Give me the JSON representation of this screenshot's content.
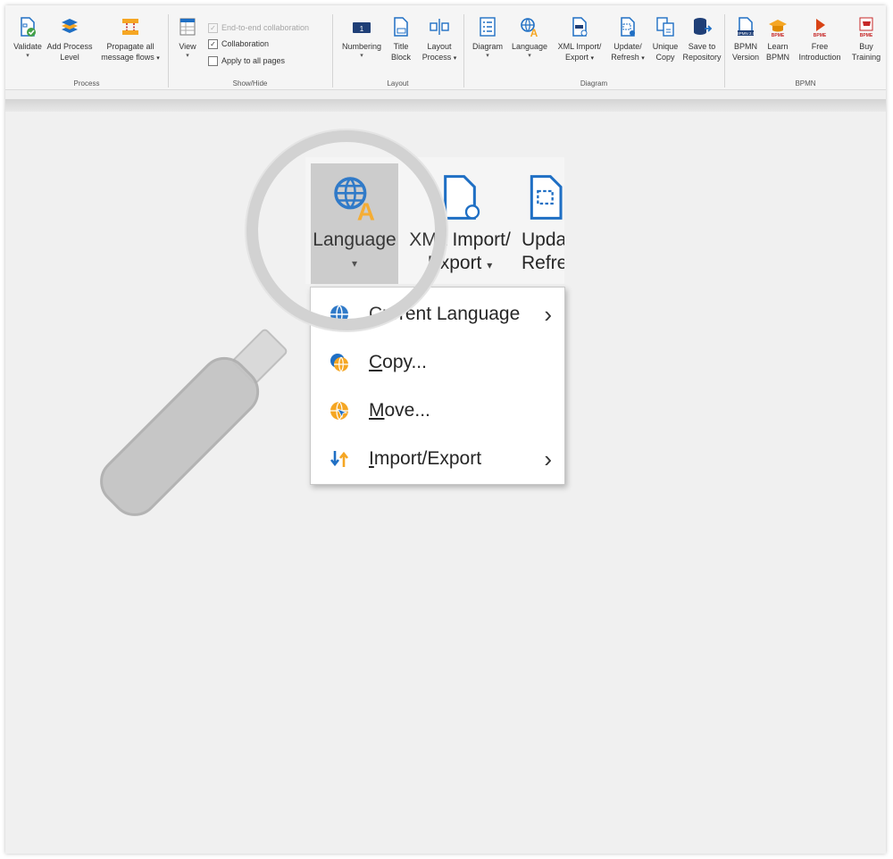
{
  "ribbon": {
    "groups": {
      "process": "Process",
      "show_hide": "Show/Hide",
      "layout": "Layout",
      "diagram": "Diagram",
      "bpmn": "BPMN"
    },
    "buttons": {
      "validate": "Validate",
      "add_process_level_1": "Add Process",
      "add_process_level_2": "Level",
      "propagate_1": "Propagate all",
      "propagate_2": "message flows",
      "view": "View",
      "numbering": "Numbering",
      "title_block_1": "Title",
      "title_block_2": "Block",
      "layout_process_1": "Layout",
      "layout_process_2": "Process",
      "diagram": "Diagram",
      "language": "Language",
      "xml_1": "XML Import/",
      "xml_2": "Export",
      "update_1": "Update/",
      "update_2": "Refresh",
      "unique_1": "Unique",
      "unique_2": "Copy",
      "save_1": "Save to",
      "save_2": "Repository",
      "bpmn_version_1": "BPMN",
      "bpmn_version_2": "Version",
      "learn_1": "Learn",
      "learn_2": "BPMN",
      "free_1": "Free",
      "free_2": "Introduction",
      "buy_1": "Buy",
      "buy_2": "Training"
    },
    "checkboxes": {
      "end_to_end": "End-to-end collaboration",
      "collaboration": "Collaboration",
      "apply_all": "Apply to all pages"
    },
    "checkbox_state": {
      "end_to_end": true,
      "collaboration": true,
      "apply_all": false
    },
    "caret": "▾"
  },
  "zoom": {
    "language": "Language",
    "xml_1": "XML Import/",
    "xml_2": "Export",
    "update_1": "Update/",
    "update_2": "Refresh",
    "caret": "▾"
  },
  "language_menu": {
    "items": [
      {
        "label": "Current Language",
        "accel": "",
        "submenu": true,
        "icon": "globe-icon"
      },
      {
        "label": "Copy...",
        "accel": "C",
        "submenu": false,
        "icon": "globe-copy-icon"
      },
      {
        "label": "Move...",
        "accel": "M",
        "submenu": false,
        "icon": "globe-move-icon"
      },
      {
        "label": "Import/Export",
        "accel": "I",
        "submenu": true,
        "icon": "import-export-icon"
      }
    ],
    "submenu_arrow": "›"
  },
  "colors": {
    "accent_blue": "#1f6fc4",
    "accent_orange": "#f5a623",
    "ribbon_bg": "#f5f5f5",
    "active_button": "#c8c8c8"
  }
}
